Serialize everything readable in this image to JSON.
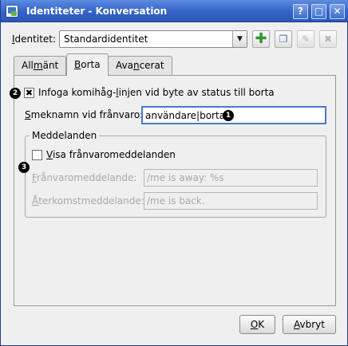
{
  "window": {
    "title": "Identiteter - Konversation",
    "buttons": {
      "help": "?",
      "maximize": "□",
      "close": "✕"
    }
  },
  "identity": {
    "label_accel": "I",
    "label_rest": "dentitet:",
    "selected": "Standardidentitet"
  },
  "toolbar_icons": [
    "add-icon",
    "copy-icon",
    "edit-icon",
    "delete-icon"
  ],
  "tabs": [
    {
      "pre": "All",
      "accel": "m",
      "post": "änt"
    },
    {
      "pre": "",
      "accel": "B",
      "post": "orta"
    },
    {
      "pre": "Ava",
      "accel": "n",
      "post": "cerat"
    }
  ],
  "away": {
    "badge1": "1",
    "badge2": "2",
    "badge3": "3",
    "insert_line": {
      "pre": "Infoga komihåg-",
      "accel": "l",
      "post": "injen vid byte av status till borta",
      "checked": true
    },
    "nickname_label": {
      "pre": "",
      "accel": "S",
      "post": "meknamn vid frånvaro:"
    },
    "nickname_value": "användare|borta",
    "messages_group": "Meddelanden",
    "show_messages": {
      "pre": "",
      "accel": "V",
      "post": "isa frånvaromeddelanden",
      "checked": false
    },
    "away_msg_label": {
      "pre": "",
      "accel": "F",
      "post": "rånvaromeddelande:"
    },
    "away_msg_value": "/me is away: %s",
    "back_msg_label": {
      "pre": "",
      "accel": "Å",
      "post": "terkomstmeddelande:"
    },
    "back_msg_value": "/me is back."
  },
  "buttons": {
    "ok": {
      "accel": "O",
      "post": "K"
    },
    "cancel": {
      "accel": "A",
      "post": "vbryt"
    }
  }
}
